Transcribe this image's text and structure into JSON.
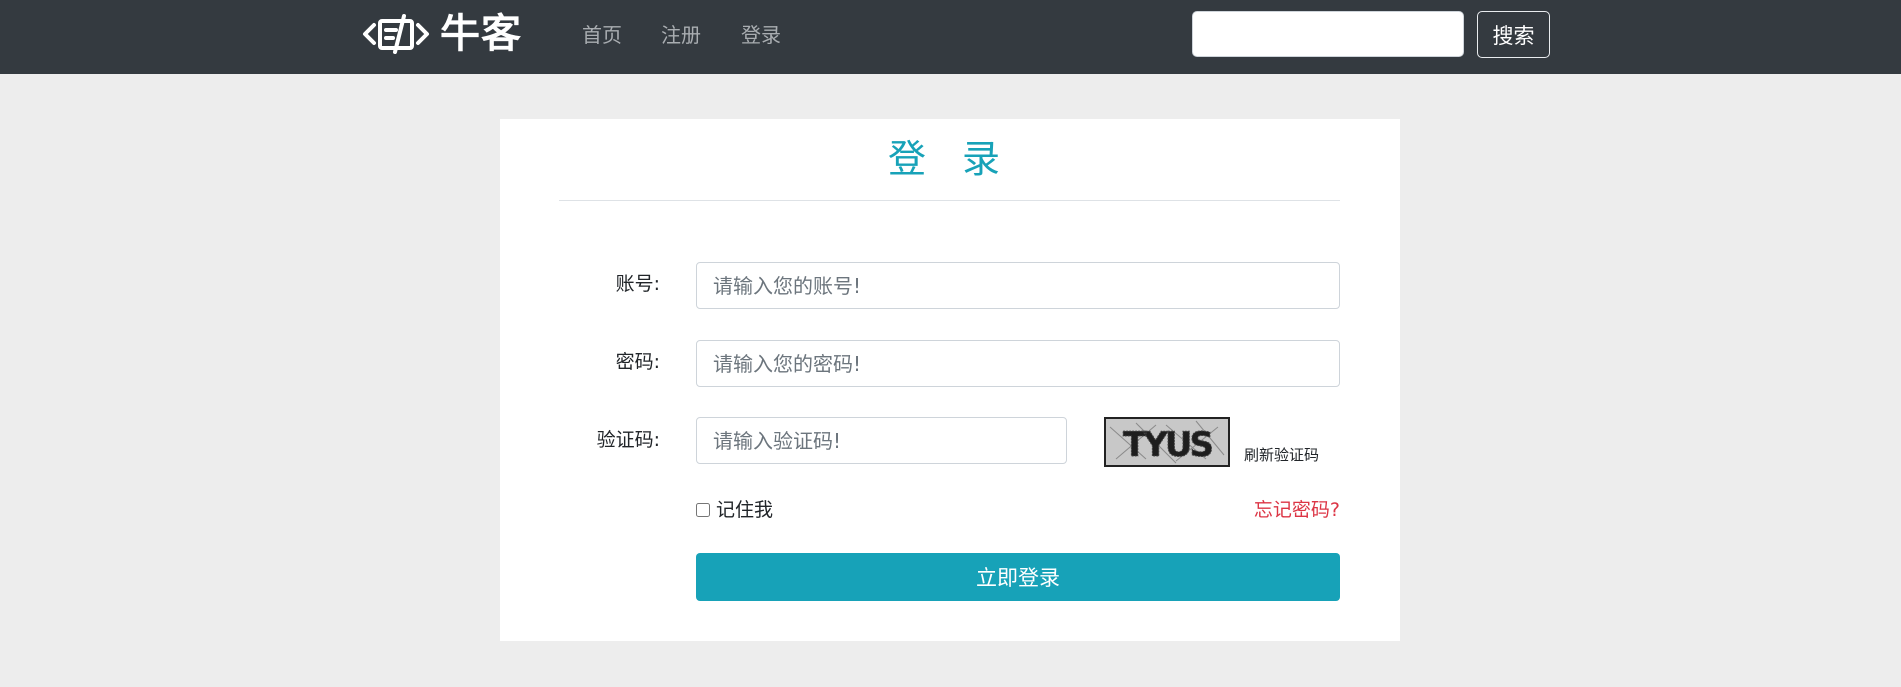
{
  "navbar": {
    "brand": "牛客",
    "links": [
      "首页",
      "注册",
      "登录"
    ],
    "search": {
      "value": "",
      "placeholder": ""
    },
    "search_button": "搜索"
  },
  "login": {
    "title": "登 录",
    "account": {
      "label": "账号:",
      "placeholder": "请输入您的账号!"
    },
    "password": {
      "label": "密码:",
      "placeholder": "请输入您的密码!"
    },
    "captcha": {
      "label": "验证码:",
      "placeholder": "请输入验证码!",
      "image_text": "TYUS",
      "refresh": "刷新验证码"
    },
    "remember": {
      "label": "记住我",
      "checked": false
    },
    "forgot": "忘记密码?",
    "submit": "立即登录"
  },
  "colors": {
    "navbar_bg": "#343a40",
    "accent": "#17a2b8",
    "danger": "#dc3545",
    "page_bg": "#ededed"
  },
  "icons": {
    "brand_logo": "bracket-code-logo-icon"
  }
}
